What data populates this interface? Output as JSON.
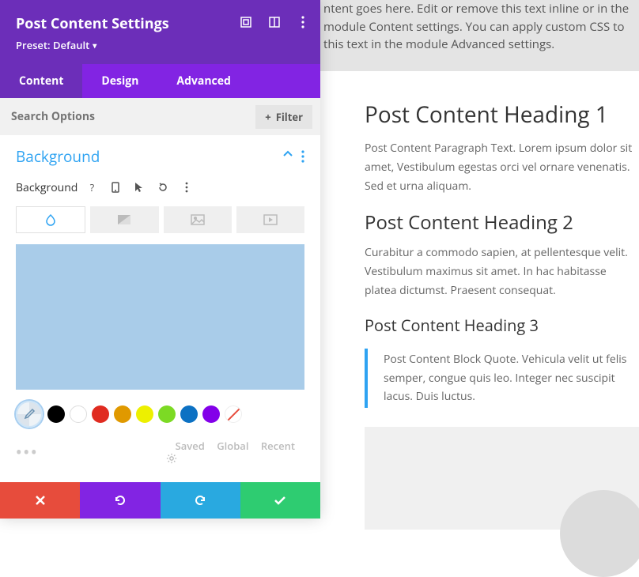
{
  "header": {
    "title": "Post Content Settings",
    "preset_label": "Preset: Default"
  },
  "tabs": {
    "content": "Content",
    "design": "Design",
    "advanced": "Advanced"
  },
  "search": {
    "placeholder": "Search Options",
    "filter_label": "Filter"
  },
  "section": {
    "title": "Background",
    "field_label": "Background"
  },
  "palette": {
    "colors": [
      "#000000",
      "#ffffff",
      "#e02b20",
      "#e09900",
      "#edf000",
      "#7cda24",
      "#0c71c3",
      "#8300e9"
    ]
  },
  "footer_meta": {
    "saved": "Saved",
    "global": "Global",
    "recent": "Recent"
  },
  "page": {
    "top_text": "ntent goes here. Edit or remove this text inline or in the module Content settings. You can apply custom CSS to this text in the module Advanced settings.",
    "h1": "Post Content Heading 1",
    "p1": "Post Content Paragraph Text. Lorem ipsum dolor sit amet, Vestibulum egestas orci vel ornare venenatis. Sed et urna aliquam.",
    "h2": "Post Content Heading 2",
    "p2": "Curabitur a commodo sapien, at pellentesque velit. Vestibulum maximus sit amet. In hac habitasse platea dictumst. Praesent consequat.",
    "h3": "Post Content Heading 3",
    "bq": "Post Content Block Quote. Vehicula velit ut felis semper, congue quis leo. Integer nec suscipit lacus. Duis luctus."
  }
}
